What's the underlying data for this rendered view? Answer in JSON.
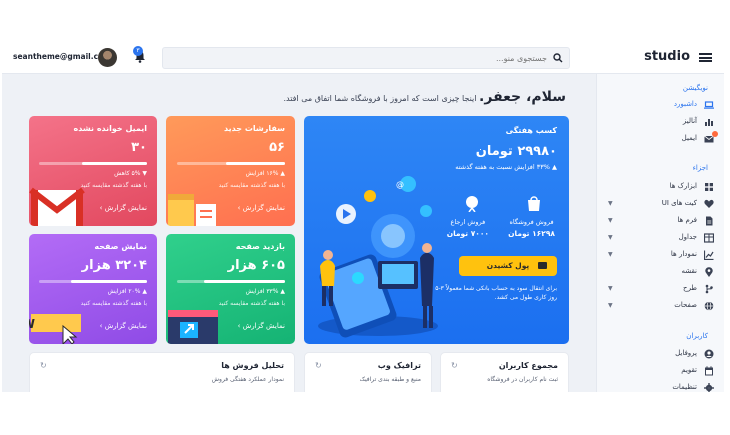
{
  "topbar": {
    "brand": "studio",
    "search_placeholder": "جستجوی منو...",
    "user_email": "seantheme@gmail.com",
    "notif_count": "۳"
  },
  "sidebar": {
    "section_nav": "نویگیشن",
    "section_data": "اجزاء",
    "section_users": "کاربران",
    "nav": [
      {
        "label": "داشبورد",
        "icon": "laptop-icon",
        "active": true
      },
      {
        "label": "آنالیز",
        "icon": "bar-chart-icon"
      },
      {
        "label": "ایمیل",
        "icon": "mail-icon",
        "badge": true
      }
    ],
    "components": [
      {
        "label": "ابزارک ها",
        "icon": "grid-icon"
      },
      {
        "label": "کیت های UI",
        "icon": "heart-icon",
        "chevron": true
      },
      {
        "label": "فرم ها",
        "icon": "file-icon",
        "chevron": true
      },
      {
        "label": "جداول",
        "icon": "table-icon",
        "chevron": true
      },
      {
        "label": "نمودار ها",
        "icon": "chart-icon",
        "chevron": true
      },
      {
        "label": "نقشه",
        "icon": "map-pin-icon"
      },
      {
        "label": "طرح",
        "icon": "layout-icon",
        "chevron": true
      },
      {
        "label": "صفحات",
        "icon": "globe-icon",
        "chevron": true
      }
    ],
    "users": [
      {
        "label": "پروفایل",
        "icon": "user-icon"
      },
      {
        "label": "تقویم",
        "icon": "calendar-icon"
      },
      {
        "label": "تنظیمات",
        "icon": "gear-icon"
      }
    ]
  },
  "greeting": {
    "name": "سلام، جعفر.",
    "text": "اینجا چیزی است که امروز با فروشگاه شما اتفاق می افتد."
  },
  "weekly": {
    "title": "کسب هفتگی",
    "value": "۲۹۹۸۰ تومان",
    "change": "▲ ۳۳% افزایش نسبت به هفته گذشته",
    "stat1_label": "فروش فروشگاه",
    "stat1_value": "۱۶۲۹۸ تومان",
    "stat2_label": "فروش ارجاع",
    "stat2_value": "۷۰۰۰ تومان",
    "pay_button": "پول کشیدن",
    "note": "برای انتقال سود به حساب بانکی شما معمولاً ۳-۵ روز کاری طول می کشد."
  },
  "cards": {
    "orders": {
      "title": "سفارشات جدید",
      "value": "۵۶",
      "change": "▲ ۱۶% افزایش",
      "compare": "با هفته گذشته مقایسه کنید",
      "link": "نمایش گزارش ›",
      "progress": 0.55
    },
    "email": {
      "title": "ایمیل خوانده نشده",
      "value": "۳۰",
      "change": "▼ ۵% کاهش",
      "compare": "با هفته گذشته مقایسه کنید",
      "link": "نمایش گزارش ›",
      "progress": 0.6
    },
    "visits": {
      "title": "بازدید صفحه",
      "value": "۶۰۵ هزار",
      "change": "▲ ۳۳% افزایش",
      "compare": "با هفته گذشته مقایسه کنید",
      "link": "نمایش گزارش ›",
      "progress": 0.75
    },
    "views": {
      "title": "نمایش صفحه",
      "value": "۳۲۰۴ هزار",
      "change": "▲ ۲۰% افزایش",
      "compare": "با هفته گذشته مقایسه کنید",
      "link": "نمایش گزارش ›",
      "progress": 0.7
    }
  },
  "widgets": [
    {
      "title": "مجموع کاربران",
      "subtitle": "ثبت نام کاربران در فروشگاه"
    },
    {
      "title": "ترافیک وب",
      "subtitle": "منبع و طبقه بندی ترافیک"
    },
    {
      "title": "تحلیل فروش ها",
      "subtitle": "نمودار عملکرد هفتگی فروش"
    }
  ],
  "colors": {
    "accent": "#2b74ee",
    "pay": "#ffc20e"
  }
}
